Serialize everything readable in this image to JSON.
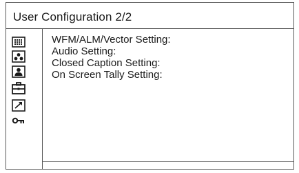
{
  "window": {
    "title": "User Configuration 2/2"
  },
  "sidebar": {
    "items": [
      {
        "icon": "keyboard-icon"
      },
      {
        "icon": "audio-channels-icon"
      },
      {
        "icon": "user-icon"
      },
      {
        "icon": "toolbox-icon",
        "selected": true
      },
      {
        "icon": "arrow-icon"
      },
      {
        "icon": "key-icon"
      }
    ]
  },
  "menu": {
    "items": [
      {
        "label": "WFM/ALM/Vector Setting:"
      },
      {
        "label": "Audio Setting:"
      },
      {
        "label": "Closed Caption Setting:"
      },
      {
        "label": "On Screen Tally Setting:"
      }
    ]
  },
  "colors": {
    "border": "#555555",
    "text": "#1a1a1a",
    "selected_icon_bg": "#1a1a1a"
  }
}
